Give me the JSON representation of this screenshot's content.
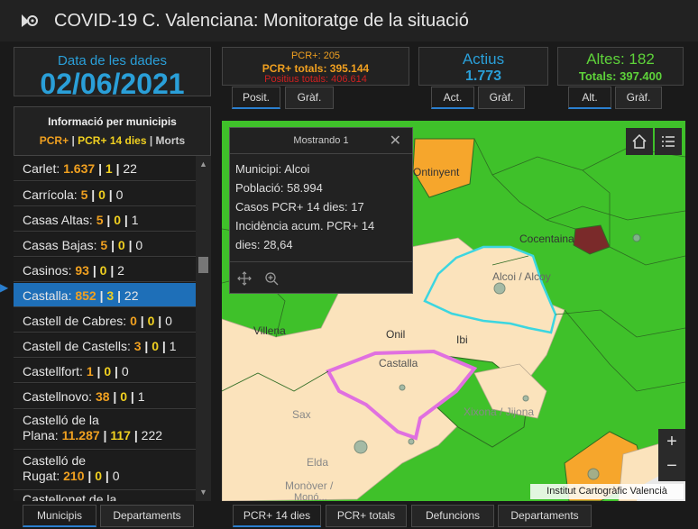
{
  "header": {
    "title": "COVID-19 C. Valenciana: Monitoratge de la situació"
  },
  "date": {
    "label": "Data de les dades",
    "value": "02/06/2021"
  },
  "pcr": {
    "line1": "PCR+: 205",
    "line2": "PCR+ totals: 395.144",
    "line3": "Positius totals: 406.614",
    "tabs": [
      "Posit.",
      "Gràf."
    ]
  },
  "actius": {
    "label": "Actius",
    "value": "1.773",
    "tabs": [
      "Act.",
      "Gràf."
    ]
  },
  "altes": {
    "label": "Altes: 182",
    "total": "Totals: 397.400",
    "tabs": [
      "Alt.",
      "Gràf."
    ]
  },
  "list": {
    "title": "Informació per municipis",
    "legend_pcr": "PCR+",
    "legend_sep1": " | ",
    "legend_pcr14": "PCR+ 14 dies",
    "legend_sep2": " | ",
    "legend_morts": "Morts",
    "rows": [
      {
        "name": "Carlet:",
        "pcr": "1.637",
        "p14": "1",
        "morts": "22"
      },
      {
        "name": "Carrícola:",
        "pcr": "5",
        "p14": "0",
        "morts": "0"
      },
      {
        "name": "Casas Altas:",
        "pcr": "5",
        "p14": "0",
        "morts": "1"
      },
      {
        "name": "Casas Bajas:",
        "pcr": "5",
        "p14": "0",
        "morts": "0"
      },
      {
        "name": "Casinos:",
        "pcr": "93",
        "p14": "0",
        "morts": "2"
      },
      {
        "name": "Castalla:",
        "pcr": "852",
        "p14": "3",
        "morts": "22"
      },
      {
        "name": "Castell de Cabres:",
        "pcr": "0",
        "p14": "0",
        "morts": "0"
      },
      {
        "name": "Castell de Castells:",
        "pcr": "3",
        "p14": "0",
        "morts": "1"
      },
      {
        "name": "Castellfort:",
        "pcr": "1",
        "p14": "0",
        "morts": "0"
      },
      {
        "name": "Castellnovo:",
        "pcr": "38",
        "p14": "0",
        "morts": "1"
      },
      {
        "name1": "Castelló de la",
        "name2": "Plana:",
        "pcr": "11.287",
        "p14": "117",
        "morts": "222"
      },
      {
        "name1": "Castelló de",
        "name2": "Rugat:",
        "pcr": "210",
        "p14": "0",
        "morts": "0"
      },
      {
        "name1": "Castellonet de la"
      }
    ]
  },
  "popup": {
    "title": "Mostrando 1",
    "lines": [
      "Municipi: Alcoi",
      "Població: 58.994",
      "Casos PCR+ 14 dies: 17",
      "Incidència acum. PCR+ 14",
      "dies: 28,64"
    ]
  },
  "map": {
    "labels": [
      "Ontinyent",
      "Cocentaina",
      "Alcoi / Alcoy",
      "Villena",
      "Onil",
      "Ibi",
      "Castalla",
      "Sax",
      "Xixona / Jijona",
      "Elda",
      "Monòver /",
      "Monó..."
    ],
    "credit": "Institut Cartogràfic Valencià",
    "zoom_in": "+",
    "zoom_out": "−"
  },
  "bottom_left_tabs": [
    "Municipis",
    "Departaments"
  ],
  "bottom_map_tabs": [
    "PCR+ 14 dies",
    "PCR+ totals",
    "Defuncions",
    "Departaments"
  ],
  "colors": {
    "accent_blue": "#2a9fd8",
    "orange": "#f0a020",
    "red": "#d02020",
    "green": "#5ed23a",
    "selected": "#1e6fb8"
  }
}
